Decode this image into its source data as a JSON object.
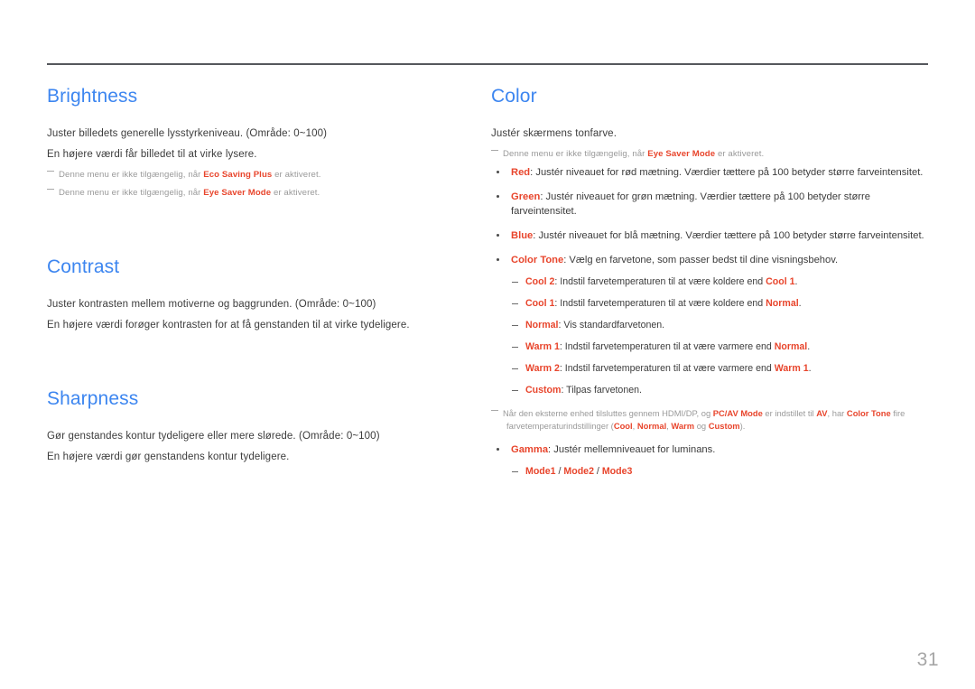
{
  "document": {
    "page_number": "31",
    "accent_color": "#e8452c",
    "heading_color": "#3d86f0",
    "note_color": "#9a9a9a",
    "rule_color": "#55585c"
  },
  "left_column": {
    "sections": [
      {
        "title": "Brightness",
        "lines": [
          "Juster billedets generelle lysstyrkeniveau. (Område: 0~100)",
          "En højere værdi får billedet til at virke lysere."
        ],
        "notes": [
          {
            "pre": "Denne menu er ikke tilgængelig, når ",
            "accent": "Eco Saving Plus",
            "post": " er aktiveret."
          },
          {
            "pre": "Denne menu er ikke tilgængelig, når ",
            "accent": "Eye Saver Mode",
            "post": " er aktiveret."
          }
        ]
      },
      {
        "title": "Contrast",
        "lines": [
          "Juster kontrasten mellem motiverne og baggrunden. (Område: 0~100)",
          "En højere værdi forøger kontrasten for at få genstanden til at virke tydeligere."
        ],
        "notes": []
      },
      {
        "title": "Sharpness",
        "lines": [
          "Gør genstandes kontur tydeligere eller mere slørede. (Område: 0~100)",
          "En højere værdi gør genstandens kontur tydeligere."
        ],
        "notes": []
      }
    ]
  },
  "right_column": {
    "section": {
      "title": "Color",
      "intro_line": "Justér skærmens tonfarve.",
      "intro_note": {
        "pre": "Denne menu er ikke tilgængelig, når ",
        "accent": "Eye Saver Mode",
        "post": " er aktiveret."
      },
      "bullets": [
        {
          "label": "Red",
          "text": ": Justér niveauet for rød mætning. Værdier tættere på 100 betyder større farveintensitet."
        },
        {
          "label": "Green",
          "text": ": Justér niveauet for grøn mætning. Værdier tættere på 100 betyder større farveintensitet."
        },
        {
          "label": "Blue",
          "text": ": Justér niveauet for blå mætning. Værdier tættere på 100 betyder større farveintensitet."
        },
        {
          "label": "Color Tone",
          "text": ": Vælg en farvetone, som passer bedst til dine visningsbehov."
        },
        {
          "label": "Gamma",
          "text": ": Justér mellemniveauet for luminans."
        }
      ],
      "color_tone_subitems": [
        {
          "label": "Cool 2",
          "mid": ": Indstil farvetemperaturen til at være koldere end ",
          "ref": "Cool 1",
          "end": "."
        },
        {
          "label": "Cool 1",
          "mid": ": Indstil farvetemperaturen til at være koldere end ",
          "ref": "Normal",
          "end": "."
        },
        {
          "label": "Normal",
          "mid": ": Vis standardfarvetonen.",
          "ref": "",
          "end": ""
        },
        {
          "label": "Warm 1",
          "mid": ": Indstil farvetemperaturen til at være varmere end ",
          "ref": "Normal",
          "end": "."
        },
        {
          "label": "Warm 2",
          "mid": ": Indstil farvetemperaturen til at være varmere end ",
          "ref": "Warm 1",
          "end": "."
        },
        {
          "label": "Custom",
          "mid": ": Tilpas farvetonen.",
          "ref": "",
          "end": ""
        }
      ],
      "color_tone_note": {
        "p1": "Når den eksterne enhed tilsluttes gennem HDMI/DP, og ",
        "a1": "PC/AV Mode",
        "p2": " er indstillet til ",
        "a2": "AV",
        "p3": ", har ",
        "a3": "Color Tone",
        "p4": " fire",
        "line2_p1": "farvetemperaturindstillinger (",
        "line2_a1": "Cool",
        "line2_p2": ", ",
        "line2_a2": "Normal",
        "line2_p3": ", ",
        "line2_a3": "Warm",
        "line2_p4": " og ",
        "line2_a4": "Custom",
        "line2_p5": ")."
      },
      "gamma_subitems": [
        {
          "label": "Mode1"
        },
        {
          "label": "Mode2"
        },
        {
          "label": "Mode3"
        }
      ],
      "gamma_separator": " / "
    }
  }
}
